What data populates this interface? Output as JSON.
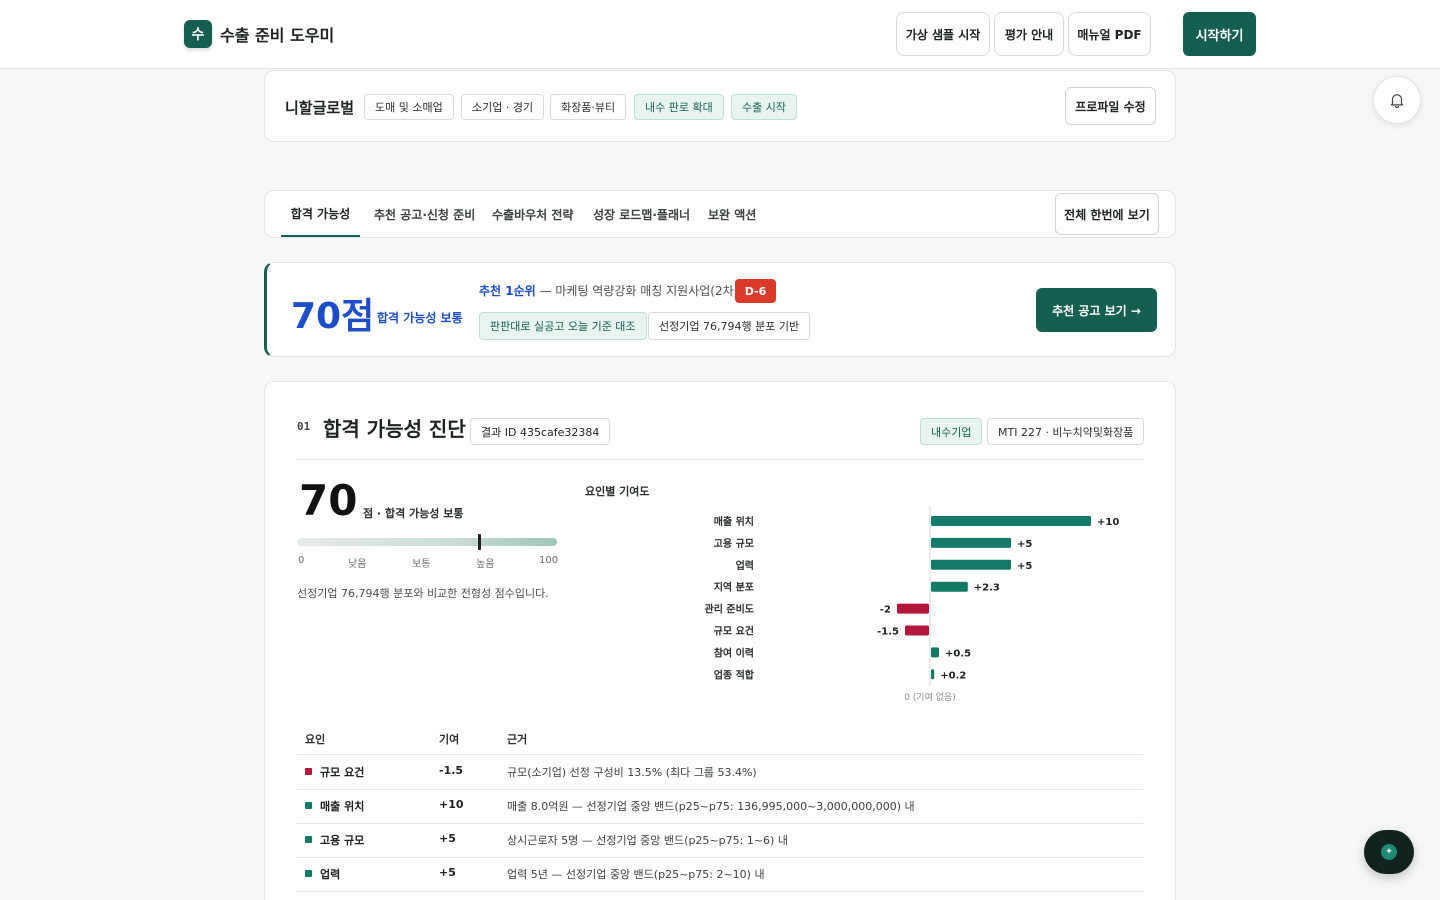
{
  "header": {
    "logo_mark": "수",
    "app_title": "수출 준비 도우미",
    "buttons": [
      "가상 샘플 시작",
      "평가 안내",
      "매뉴얼 PDF"
    ],
    "start_label": "시작하기"
  },
  "profile": {
    "company": "니할글로벌",
    "tags": [
      "도매 및 소매업",
      "소기업 · 경기",
      "화장품·뷰티"
    ],
    "green_tags": [
      "내수 판로 확대",
      "수출 시작"
    ],
    "edit_label": "프로파일 수정"
  },
  "tabs": {
    "items": [
      "합격 가능성",
      "추천 공고·신청 준비",
      "수출바우처 전략",
      "성장 로드맵·플래너",
      "보완 액션"
    ],
    "view_all": "전체 한번에 보기"
  },
  "summary": {
    "score": "70점",
    "score_label": "합격 가능성 보통",
    "rec_prefix": "추천 1순위",
    "rec_text": " — 마케팅 역량강화 매칭 지원사업(2차)",
    "dday": "D-6",
    "chip1": "판판대로 실공고 오늘 기준 대조",
    "chip2": "선정기업 76,794행 분포 기반",
    "cta": "추천 공고 보기 →"
  },
  "diagnosis": {
    "num": "01",
    "title": "합격 가능성 진단",
    "result_id": "결과 ID 435cafe32384",
    "badge_green": "내수기업",
    "badge_mti": "MTI 227 · 비누치약및화장품",
    "score": "70",
    "score_label": "점 · 합격 가능성 보통",
    "gauge_value": 70,
    "gauge_labels": [
      "0",
      "낮음",
      "보통",
      "높음",
      "100"
    ],
    "note": "선정기업 76,794행 분포와 비교한 전형성 점수입니다.",
    "chart_title": "요인별 기여도",
    "zero_label": "0 (기여 없음)",
    "table_headers": [
      "요인",
      "기여",
      "근거"
    ],
    "rows": [
      {
        "name": "규모 요건",
        "value": "-1.5",
        "reason": "규모(소기업) 선정 구성비 13.5% (최다 그룹 53.4%)",
        "color": "#b5173a"
      },
      {
        "name": "매출 위치",
        "value": "+10",
        "reason": "매출 8.0억원 — 선정기업 중앙 밴드(p25~p75: 136,995,000~3,000,000,000) 내",
        "color": "#137a67"
      },
      {
        "name": "고용 규모",
        "value": "+5",
        "reason": "상시근로자 5명 — 선정기업 중앙 밴드(p25~p75: 1~6) 내",
        "color": "#137a67"
      },
      {
        "name": "업력",
        "value": "+5",
        "reason": "업력 5년 — 선정기업 중앙 밴드(p25~p75: 2~10) 내",
        "color": "#137a67"
      }
    ]
  },
  "colors": {
    "primary": "#155f52",
    "positive": "#137a67",
    "negative": "#b5173a",
    "accent_blue": "#1d4ec9",
    "danger": "#d93a2a"
  },
  "chart_data": {
    "type": "bar",
    "orientation": "horizontal",
    "title": "요인별 기여도",
    "categories": [
      "매출 위치",
      "고용 규모",
      "업력",
      "지역 분포",
      "관리 준비도",
      "규모 요건",
      "참여 이력",
      "업종 적합"
    ],
    "values": [
      10,
      5,
      5,
      2.3,
      -2,
      -1.5,
      0.5,
      0.2
    ],
    "value_labels": [
      "+10",
      "+5",
      "+5",
      "+2.3",
      "-2",
      "-1.5",
      "+0.5",
      "+0.2"
    ],
    "xlabel": "0 (기여 없음)",
    "grid": false
  }
}
